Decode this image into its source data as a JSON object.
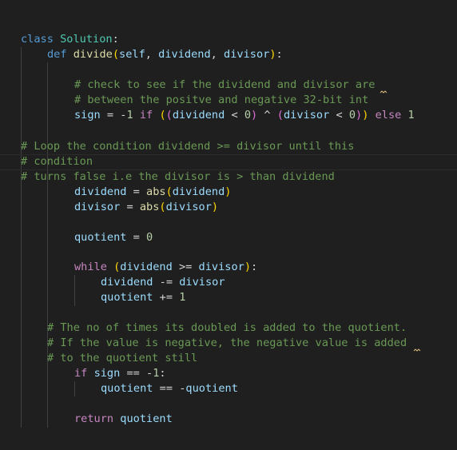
{
  "lines": {
    "l1": {
      "kw_class": "class",
      "class_name": "Solution",
      "colon": ":"
    },
    "l2": {
      "kw_def": "def",
      "fn_name": "divide",
      "paren_open": "(",
      "p_self": "self",
      "comma1": ", ",
      "p_dividend": "dividend",
      "comma2": ", ",
      "p_divisor": "divisor",
      "paren_close": ")",
      "colon": ":"
    },
    "l4": {
      "comment": "# check to see if the dividend and divisor are"
    },
    "l5": {
      "comment": "# between the positve and negative 32-bit int"
    },
    "l6": {
      "v_sign": "sign",
      "eq": " = -",
      "n_1": "1",
      "kw_if": " if ",
      "b_open1": "(",
      "b_open2": "(",
      "v_dividend": "dividend",
      "lt1": " < ",
      "n_0a": "0",
      "b_close2": ")",
      "xor": " ^ ",
      "b_open3": "(",
      "v_divisor": "divisor",
      "lt2": " < ",
      "n_0b": "0",
      "b_close3": ")",
      "b_close1": ")",
      "kw_else": " else ",
      "n_1b": "1"
    },
    "l8": {
      "comment": "# Loop the condition dividend >= divisor until this"
    },
    "l9": {
      "comment": "# condition"
    },
    "l10": {
      "comment": "# turns false i.e the divisor is > than dividend"
    },
    "l11": {
      "v_dividend": "dividend",
      "eq": " = ",
      "fn_abs": "abs",
      "b_open": "(",
      "arg": "dividend",
      "b_close": ")"
    },
    "l12": {
      "v_divisor": "divisor",
      "eq": " = ",
      "fn_abs": "abs",
      "b_open": "(",
      "arg": "divisor",
      "b_close": ")"
    },
    "l14": {
      "v_quotient": "quotient",
      "eq": " = ",
      "n_0": "0"
    },
    "l16": {
      "kw_while": "while",
      "sp": " ",
      "b_open": "(",
      "v_dividend": "dividend",
      "ge": " >= ",
      "v_divisor": "divisor",
      "b_close": ")",
      "colon": ":"
    },
    "l17": {
      "v_dividend": "dividend",
      "op": " -= ",
      "v_divisor": "divisor"
    },
    "l18": {
      "v_quotient": "quotient",
      "op": " += ",
      "n_1": "1"
    },
    "l20": {
      "comment": "# The no of times its doubled is added to the quotient."
    },
    "l21": {
      "comment": "# If the value is negative, the negative value is added"
    },
    "l22": {
      "comment": "# to the quotient still"
    },
    "l23": {
      "kw_if": "if",
      "sp": " ",
      "v_sign": "sign",
      "op": " == -",
      "n_1": "1",
      "colon": ":"
    },
    "l24": {
      "v_quotient": "quotient",
      "op": " == -",
      "v_quotient2": "quotient"
    },
    "l26": {
      "kw_return": "return",
      "sp": " ",
      "v_quotient": "quotient"
    }
  }
}
